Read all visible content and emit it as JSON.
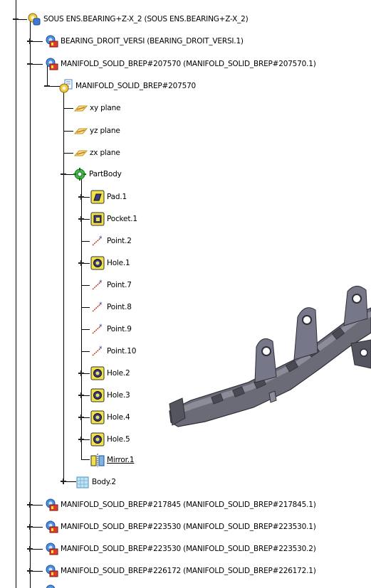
{
  "tree": {
    "root": {
      "label": "SOUS ENS.BEARING+Z-X_2 (SOUS ENS.BEARING+Z-X_2)",
      "icon": "product-icon"
    },
    "bearing": {
      "label": "BEARING_DROIT_VERSI (BEARING_DROIT_VERSI.1)",
      "icon": "component-icon"
    },
    "manifold_main": {
      "label": "MANIFOLD_SOLID_BREP#207570 (MANIFOLD_SOLID_BREP#207570.1)",
      "icon": "component-icon"
    },
    "part": {
      "label": "MANIFOLD_SOLID_BREP#207570",
      "icon": "part-icon"
    },
    "planes": [
      {
        "label": "xy plane",
        "icon": "plane-icon"
      },
      {
        "label": "yz plane",
        "icon": "plane-icon"
      },
      {
        "label": "zx plane",
        "icon": "plane-icon"
      }
    ],
    "partbody": {
      "label": "PartBody",
      "icon": "partbody-icon"
    },
    "features": [
      {
        "label": "Pad.1",
        "icon": "pad-icon",
        "expandable": true
      },
      {
        "label": "Pocket.1",
        "icon": "pocket-icon",
        "expandable": true
      },
      {
        "label": "Point.2",
        "icon": "point-icon",
        "expandable": false
      },
      {
        "label": "Hole.1",
        "icon": "hole-icon",
        "expandable": true
      },
      {
        "label": "Point.7",
        "icon": "point-icon",
        "expandable": false
      },
      {
        "label": "Point.8",
        "icon": "point-icon",
        "expandable": false
      },
      {
        "label": "Point.9",
        "icon": "point-icon",
        "expandable": false
      },
      {
        "label": "Point.10",
        "icon": "point-icon",
        "expandable": false
      },
      {
        "label": "Hole.2",
        "icon": "hole-icon",
        "expandable": true
      },
      {
        "label": "Hole.3",
        "icon": "hole-icon",
        "expandable": true
      },
      {
        "label": "Hole.4",
        "icon": "hole-icon",
        "expandable": true
      },
      {
        "label": "Hole.5",
        "icon": "hole-icon",
        "expandable": true
      },
      {
        "label": "Mirror.1",
        "icon": "mirror-icon",
        "expandable": false
      }
    ],
    "body2": {
      "label": "Body.2",
      "icon": "body-icon"
    },
    "manifolds": [
      {
        "label": "MANIFOLD_SOLID_BREP#217845 (MANIFOLD_SOLID_BREP#217845.1)"
      },
      {
        "label": "MANIFOLD_SOLID_BREP#223530 (MANIFOLD_SOLID_BREP#223530.1)"
      },
      {
        "label": "MANIFOLD_SOLID_BREP#223530 (MANIFOLD_SOLID_BREP#223530.2)"
      },
      {
        "label": "MANIFOLD_SOLID_BREP#226172 (MANIFOLD_SOLID_BREP#226172.1)"
      }
    ]
  },
  "viewer": {
    "model": "3d-part-geometry"
  },
  "colors": {
    "line": "#000000",
    "part_gray": "#6b6b78",
    "part_dark": "#3d3d47",
    "icon_yellow": "#f2e24a"
  }
}
